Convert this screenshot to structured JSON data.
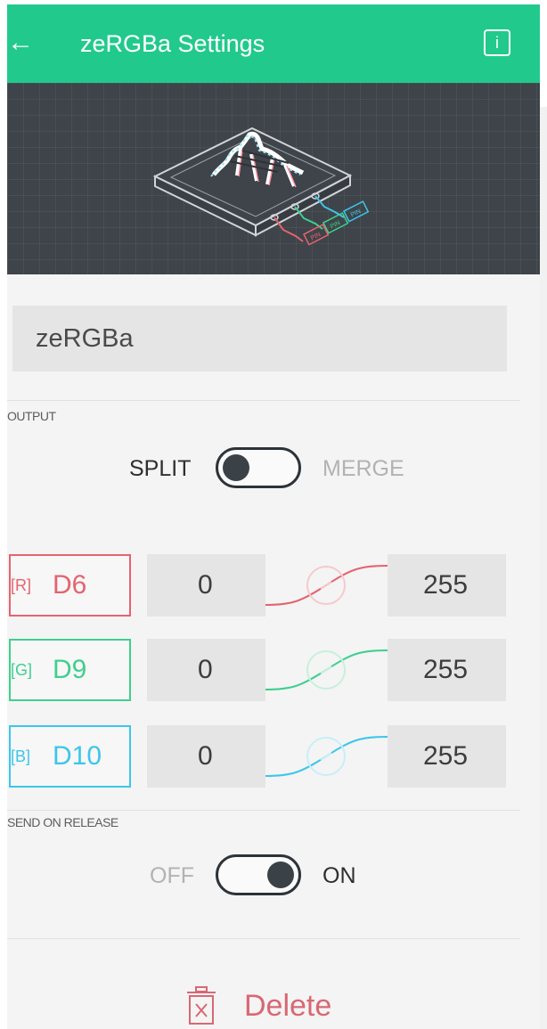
{
  "header": {
    "back_glyph": "←",
    "title": "zeRGBa Settings",
    "info_glyph": "i"
  },
  "hero": {
    "pin_tags": [
      "PIN",
      "PIN",
      "PIN"
    ]
  },
  "widget_name": {
    "value": "zeRGBa"
  },
  "output": {
    "section_label": "OUTPUT",
    "left_label": "SPLIT",
    "right_label": "MERGE",
    "selected": "SPLIT"
  },
  "pins": [
    {
      "tag": "[R]",
      "pin": "D6",
      "min": "0",
      "max": "255",
      "color": "#e5636f"
    },
    {
      "tag": "[G]",
      "pin": "D9",
      "min": "0",
      "max": "255",
      "color": "#3fcf8f"
    },
    {
      "tag": "[B]",
      "pin": "D10",
      "min": "0",
      "max": "255",
      "color": "#3cc6ea"
    }
  ],
  "send_on_release": {
    "section_label": "SEND ON RELEASE",
    "left_label": "OFF",
    "right_label": "ON",
    "selected": "ON"
  },
  "actions": {
    "delete_label": "Delete"
  },
  "colors": {
    "header": "#22c98c",
    "hero_background": "#3e4449",
    "field_background": "#e5e5e5",
    "delete": "#d86873",
    "dark": "#2d3339"
  },
  "icons": {
    "back": "arrow-left-icon",
    "info": "info-icon",
    "delete": "trash-icon",
    "link": "link-icon"
  }
}
